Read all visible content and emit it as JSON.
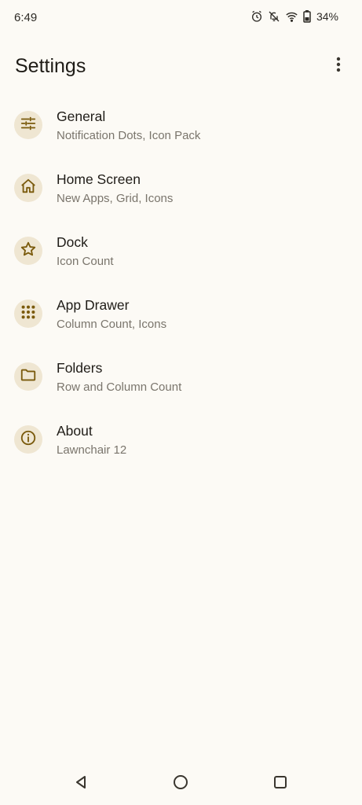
{
  "status_bar": {
    "time": "6:49",
    "battery": "34%",
    "icons": [
      "alarm-icon",
      "notifications-off-icon",
      "wifi-icon",
      "battery-icon"
    ]
  },
  "header": {
    "title": "Settings",
    "more_icon": "more-vert-icon"
  },
  "settings": {
    "items": [
      {
        "title": "General",
        "subtitle": "Notification Dots, Icon Pack",
        "icon": "tune-icon"
      },
      {
        "title": "Home Screen",
        "subtitle": "New Apps, Grid, Icons",
        "icon": "home-icon"
      },
      {
        "title": "Dock",
        "subtitle": "Icon Count",
        "icon": "star-icon"
      },
      {
        "title": "App Drawer",
        "subtitle": "Column Count, Icons",
        "icon": "apps-grid-icon"
      },
      {
        "title": "Folders",
        "subtitle": "Row and Column Count",
        "icon": "folder-icon"
      },
      {
        "title": "About",
        "subtitle": "Lawnchair 12",
        "icon": "info-icon"
      }
    ]
  },
  "nav_bar": {
    "buttons": [
      "back-icon",
      "home-circle-icon",
      "recents-icon"
    ]
  },
  "colors": {
    "background": "#fcfaf5",
    "icon_circle": "#efe6d2",
    "icon_accent": "#7a5a0c",
    "title_text": "#1f1c17",
    "subtitle_text": "#7a756c"
  }
}
